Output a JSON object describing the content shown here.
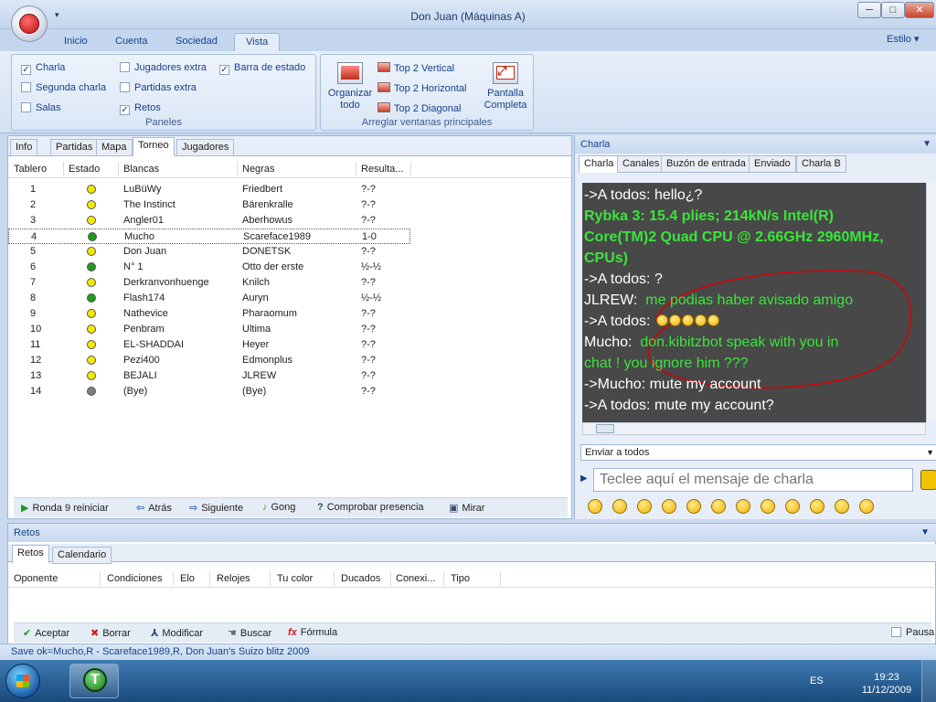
{
  "window": {
    "title": "Don Juan (Máquinas A)",
    "minimize": "─",
    "maximize": "□",
    "close": "✕"
  },
  "ribbon": {
    "tabs": [
      "Inicio",
      "Cuenta",
      "Sociedad",
      "Vista"
    ],
    "active_tab": "Vista",
    "style_menu": "Estilo",
    "paneles": {
      "label": "Paneles",
      "checks": [
        {
          "label": "Charla",
          "checked": true
        },
        {
          "label": "Segunda charla",
          "checked": false
        },
        {
          "label": "Salas",
          "checked": false
        },
        {
          "label": "Jugadores extra",
          "checked": false
        },
        {
          "label": "Partidas extra",
          "checked": false
        },
        {
          "label": "Retos",
          "checked": true
        },
        {
          "label": "Barra de estado",
          "checked": true
        }
      ]
    },
    "arreglar": {
      "label": "Arreglar ventanas principales",
      "organizar_line1": "Organizar",
      "organizar_line2": "todo",
      "top2_vertical": "Top 2 Vertical",
      "top2_horizontal": "Top 2 Horizontal",
      "top2_diagonal": "Top 2 Diagonal",
      "pantalla_line1": "Pantalla",
      "pantalla_line2": "Completa"
    }
  },
  "left_pane": {
    "tabs": [
      "Info",
      "Partidas",
      "Mapa",
      "Torneo",
      "Jugadores"
    ],
    "active_tab": "Torneo",
    "columns": [
      "Tablero",
      "Estado",
      "Blancas",
      "Negras",
      "Resulta..."
    ],
    "rows": [
      {
        "board": "1",
        "status": "yellow",
        "white": "LuBüWy",
        "black": "Friedbert",
        "result": "?-?"
      },
      {
        "board": "2",
        "status": "yellow",
        "white": "The Instinct",
        "black": "Bärenkralle",
        "result": "?-?"
      },
      {
        "board": "3",
        "status": "yellow",
        "white": "Angler01",
        "black": "Aberhowus",
        "result": "?-?"
      },
      {
        "board": "4",
        "status": "green",
        "white": "Mucho",
        "black": "Scareface1989",
        "result": "1-0"
      },
      {
        "board": "5",
        "status": "yellow",
        "white": "Don Juan",
        "black": "DONETSK",
        "result": "?-?"
      },
      {
        "board": "6",
        "status": "green",
        "white": "N° 1",
        "black": "Otto der erste",
        "result": "½-½"
      },
      {
        "board": "7",
        "status": "yellow",
        "white": "Derkranvonhuenge",
        "black": "Knilch",
        "result": "?-?"
      },
      {
        "board": "8",
        "status": "green",
        "white": "Flash174",
        "black": "Auryn",
        "result": "½-½"
      },
      {
        "board": "9",
        "status": "yellow",
        "white": "Nathevice",
        "black": "Pharaomum",
        "result": "?-?"
      },
      {
        "board": "10",
        "status": "yellow",
        "white": "Penbram",
        "black": "Ultima",
        "result": "?-?"
      },
      {
        "board": "11",
        "status": "yellow",
        "white": "EL-SHADDAI",
        "black": "Heyer",
        "result": "?-?"
      },
      {
        "board": "12",
        "status": "yellow",
        "white": "Pezi400",
        "black": "Edmonplus",
        "result": "?-?"
      },
      {
        "board": "13",
        "status": "yellow",
        "white": "BEJALI",
        "black": "JLREW",
        "result": "?-?"
      },
      {
        "board": "14",
        "status": "gray",
        "white": "(Bye)",
        "black": "(Bye)",
        "result": "?-?"
      }
    ],
    "selected_board": "4",
    "status_colors": {
      "yellow": "#f5e800",
      "green": "#1e9a1e",
      "gray": "#7d7d7d"
    },
    "toolbar": {
      "ronda": "Ronda 9 reiniciar",
      "atras": "Atrás",
      "siguiente": "Siguiente",
      "gong": "Gong",
      "comprobar": "Comprobar presencia",
      "mirar": "Mirar"
    }
  },
  "chat": {
    "header": "Charla",
    "tabs": [
      "Charla",
      "Canales",
      "Buzón de entrada",
      "Enviado",
      "Charla B"
    ],
    "active_tab": "Charla",
    "lines": [
      {
        "text": "->A todos: hello¿?",
        "style": "white"
      },
      {
        "text": "Rybka 3: 15.4 plies; 214kN/s Intel(R)",
        "style": "green-bold"
      },
      {
        "text": "Core(TM)2 Quad CPU @ 2.66GHz 2960MHz,",
        "style": "green-bold"
      },
      {
        "text": "CPUs)",
        "style": "green-bold"
      },
      {
        "text": "->A todos: ?",
        "style": "white"
      },
      {
        "speaker": "JLREW:",
        "text": "me podias haber avisado amigo",
        "style": "mixed"
      },
      {
        "text": "->A todos:",
        "style": "white",
        "emoticons": 5
      },
      {
        "speaker": "Mucho:",
        "text": "don.kibitzbot speak with you in",
        "style": "mixed"
      },
      {
        "text": "chat ! you ignore him ???",
        "style": "green"
      },
      {
        "text": "->Mucho: mute my account",
        "style": "white"
      },
      {
        "text": "->A todos: mute my account?",
        "style": "white"
      }
    ],
    "send_to": "Enviar a todos",
    "input_placeholder": "Teclee aquí el mensaje de charla",
    "smiley_count": 12
  },
  "retos": {
    "header": "Retos",
    "tabs": [
      "Retos",
      "Calendario"
    ],
    "active_tab": "Retos",
    "columns": [
      "Oponente",
      "Condiciones",
      "Elo",
      "Relojes",
      "Tu color",
      "Ducados",
      "Conexi...",
      "Tipo"
    ],
    "toolbar": {
      "aceptar": "Aceptar",
      "borrar": "Borrar",
      "modificar": "Modificar",
      "buscar": "Buscar",
      "formula": "Fórmula",
      "pausa": "Pausa"
    }
  },
  "status_bar": "Save ok=Mucho,R - Scareface1989,R, Don Juan's Suizo blitz 2009",
  "taskbar": {
    "language": "ES",
    "time": "19:23",
    "date": "11/12/2009",
    "app_letter": "T"
  }
}
